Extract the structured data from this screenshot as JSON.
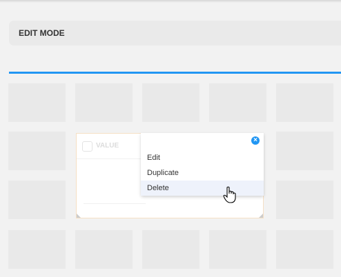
{
  "header": {
    "title": "EDIT MODE"
  },
  "widget": {
    "label": "VALUE"
  },
  "context_menu": {
    "items": [
      {
        "label": "Edit"
      },
      {
        "label": "Duplicate"
      },
      {
        "label": "Delete",
        "highlighted": true
      }
    ],
    "close_icon": "close-circle-icon"
  },
  "colors": {
    "accent": "#2196f3",
    "hover": "#eef2fb",
    "widget_border": "#f5dfc4"
  }
}
